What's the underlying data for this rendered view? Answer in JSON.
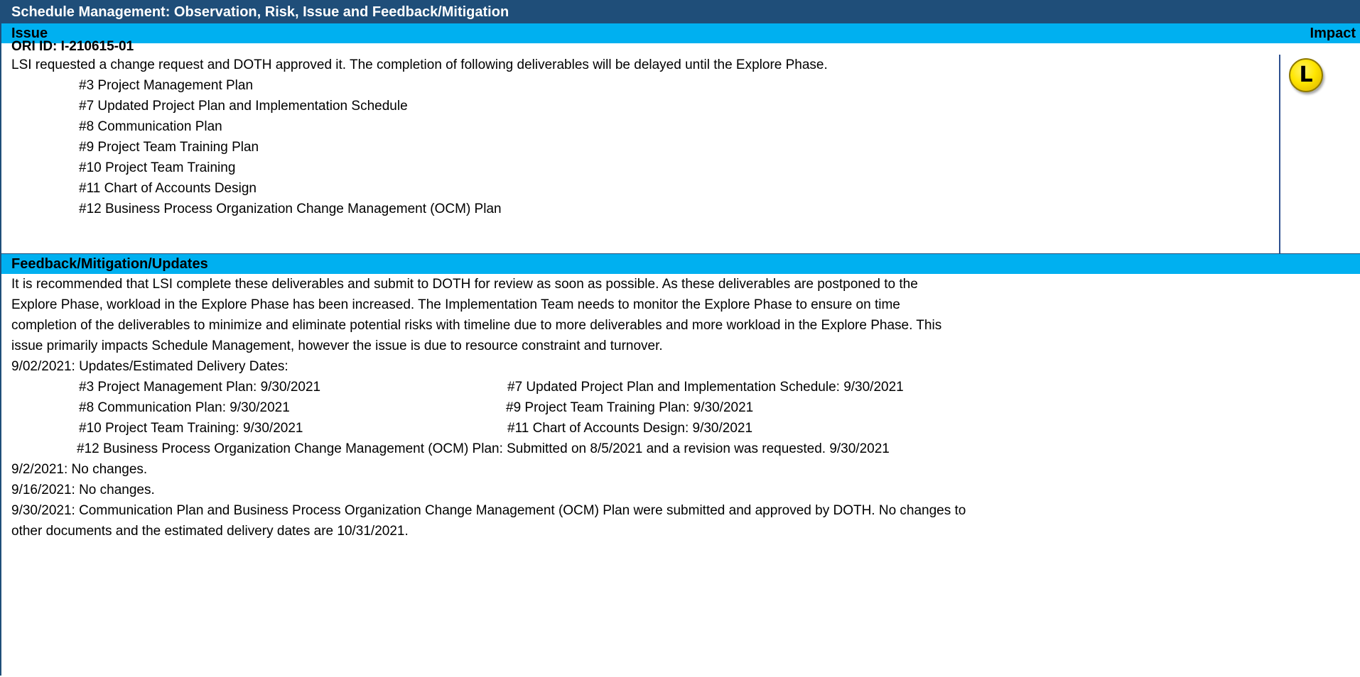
{
  "title": "Schedule Management: Observation, Risk, Issue and Feedback/Mitigation",
  "issue_header": {
    "label": "Issue",
    "impact_label": "Impact"
  },
  "issue": {
    "ori_id": "ORI ID: I-210615-01",
    "description": "LSI requested a change request and DOTH approved it. The completion of following deliverables will be delayed until the Explore Phase.",
    "deliverables": [
      "#3  Project Management Plan",
      "#7  Updated Project Plan and Implementation Schedule",
      "#8  Communication Plan",
      "#9  Project Team Training Plan",
      "#10  Project Team Training",
      "#11  Chart of Accounts Design",
      "#12  Business Process Organization Change Management (OCM) Plan"
    ],
    "impact_level": "L",
    "impact_color": "#ffe600"
  },
  "feedback": {
    "header": "Feedback/Mitigation/Updates",
    "lines": [
      "It is recommended that LSI complete these deliverables and submit to DOTH for review as soon as possible. As these deliverables are postponed to the",
      "Explore Phase, workload in the Explore Phase has been increased. The Implementation Team needs to monitor the Explore Phase to ensure on time",
      "completion of the deliverables to minimize and eliminate potential risks with timeline due to more deliverables and more workload in the Explore Phase.  This",
      "issue primarily impacts Schedule Management, however the issue is due to resource constraint and turnover."
    ],
    "updates_header": "9/02/2021: Updates/Estimated Delivery Dates:",
    "dates_left": [
      "#3  Project Management Plan: 9/30/2021",
      "#8  Communication Plan: 9/30/2021",
      "#10  Project Team Training: 9/30/2021"
    ],
    "dates_right": [
      "#7  Updated Project Plan and Implementation Schedule: 9/30/2021",
      "#9  Project Team Training Plan: 9/30/2021",
      "#11  Chart of Accounts Design: 9/30/2021"
    ],
    "date_12": "#12  Business Process Organization Change Management (OCM) Plan: Submitted on 8/5/2021 and a revision was requested. 9/30/2021",
    "update_0902": "9/2/2021: No changes.",
    "update_0916": "9/16/2021: No changes.",
    "update_0930_a": "9/30/2021: Communication Plan and Business Process Organization Change Management (OCM) Plan were submitted and approved by DOTH.  No changes to",
    "update_0930_b": "other documents and the estimated delivery dates are 10/31/2021."
  },
  "colors": {
    "title_bg": "#1f4e79",
    "header_bg": "#00b0f0",
    "title_text": "#ffffff"
  }
}
